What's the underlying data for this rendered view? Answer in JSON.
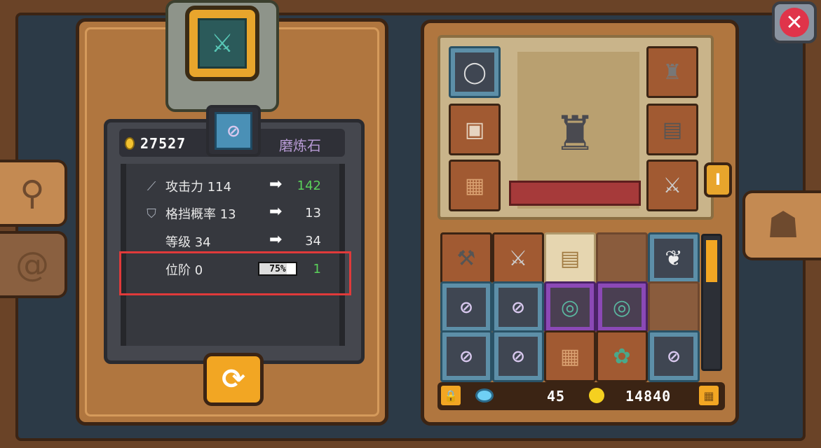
{
  "close_button": {
    "icon": "close-icon"
  },
  "side_tabs": [
    {
      "icon": "magnify-bone-icon"
    },
    {
      "icon": "swirl-icon"
    }
  ],
  "right_side_tab": {
    "icon": "helmet-icon"
  },
  "upgrade_panel": {
    "coin_count": "27527",
    "material_name": "磨炼石",
    "stats": [
      {
        "icon": "sword-icon",
        "label": "攻击力 114",
        "new_value": "142",
        "new_color": "#5ad05a"
      },
      {
        "icon": "shield-icon",
        "label": "格挡概率 13",
        "new_value": "13",
        "new_color": "#e8e8e8"
      },
      {
        "icon": "",
        "label": "等级 34",
        "new_value": "34",
        "new_color": "#e8e8e8"
      },
      {
        "icon": "",
        "label": "位阶 0",
        "new_value": "1",
        "new_color": "#5ad05a"
      }
    ],
    "rank_progress_label": "75%",
    "rank_progress": 0.75
  },
  "tier_tab_label": "I",
  "currency": {
    "gems": "45",
    "gold": "14840"
  }
}
